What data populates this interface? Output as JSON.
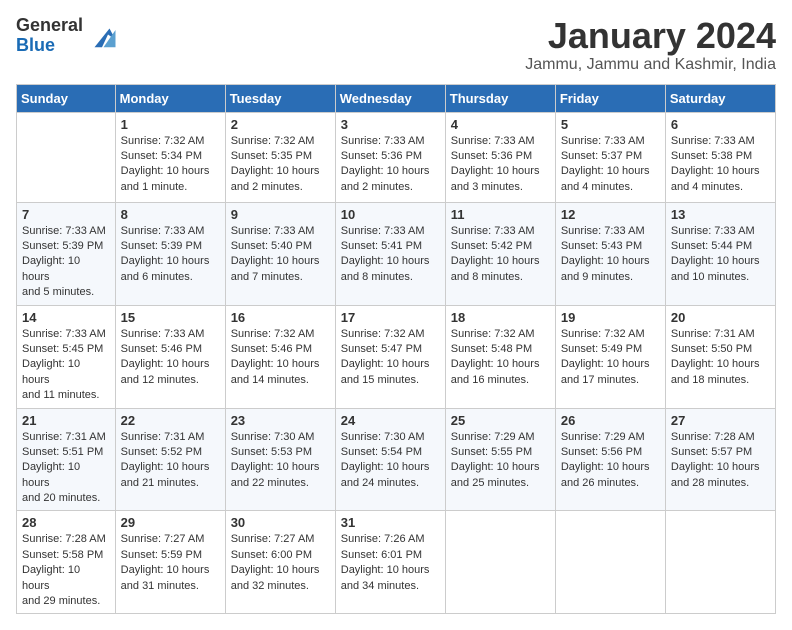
{
  "header": {
    "logo_general": "General",
    "logo_blue": "Blue",
    "month_title": "January 2024",
    "location": "Jammu, Jammu and Kashmir, India"
  },
  "weekdays": [
    "Sunday",
    "Monday",
    "Tuesday",
    "Wednesday",
    "Thursday",
    "Friday",
    "Saturday"
  ],
  "weeks": [
    [
      {
        "day": "",
        "info": ""
      },
      {
        "day": "1",
        "info": "Sunrise: 7:32 AM\nSunset: 5:34 PM\nDaylight: 10 hours\nand 1 minute."
      },
      {
        "day": "2",
        "info": "Sunrise: 7:32 AM\nSunset: 5:35 PM\nDaylight: 10 hours\nand 2 minutes."
      },
      {
        "day": "3",
        "info": "Sunrise: 7:33 AM\nSunset: 5:36 PM\nDaylight: 10 hours\nand 2 minutes."
      },
      {
        "day": "4",
        "info": "Sunrise: 7:33 AM\nSunset: 5:36 PM\nDaylight: 10 hours\nand 3 minutes."
      },
      {
        "day": "5",
        "info": "Sunrise: 7:33 AM\nSunset: 5:37 PM\nDaylight: 10 hours\nand 4 minutes."
      },
      {
        "day": "6",
        "info": "Sunrise: 7:33 AM\nSunset: 5:38 PM\nDaylight: 10 hours\nand 4 minutes."
      }
    ],
    [
      {
        "day": "7",
        "info": "Sunrise: 7:33 AM\nSunset: 5:39 PM\nDaylight: 10 hours\nand 5 minutes."
      },
      {
        "day": "8",
        "info": "Sunrise: 7:33 AM\nSunset: 5:39 PM\nDaylight: 10 hours\nand 6 minutes."
      },
      {
        "day": "9",
        "info": "Sunrise: 7:33 AM\nSunset: 5:40 PM\nDaylight: 10 hours\nand 7 minutes."
      },
      {
        "day": "10",
        "info": "Sunrise: 7:33 AM\nSunset: 5:41 PM\nDaylight: 10 hours\nand 8 minutes."
      },
      {
        "day": "11",
        "info": "Sunrise: 7:33 AM\nSunset: 5:42 PM\nDaylight: 10 hours\nand 8 minutes."
      },
      {
        "day": "12",
        "info": "Sunrise: 7:33 AM\nSunset: 5:43 PM\nDaylight: 10 hours\nand 9 minutes."
      },
      {
        "day": "13",
        "info": "Sunrise: 7:33 AM\nSunset: 5:44 PM\nDaylight: 10 hours\nand 10 minutes."
      }
    ],
    [
      {
        "day": "14",
        "info": "Sunrise: 7:33 AM\nSunset: 5:45 PM\nDaylight: 10 hours\nand 11 minutes."
      },
      {
        "day": "15",
        "info": "Sunrise: 7:33 AM\nSunset: 5:46 PM\nDaylight: 10 hours\nand 12 minutes."
      },
      {
        "day": "16",
        "info": "Sunrise: 7:32 AM\nSunset: 5:46 PM\nDaylight: 10 hours\nand 14 minutes."
      },
      {
        "day": "17",
        "info": "Sunrise: 7:32 AM\nSunset: 5:47 PM\nDaylight: 10 hours\nand 15 minutes."
      },
      {
        "day": "18",
        "info": "Sunrise: 7:32 AM\nSunset: 5:48 PM\nDaylight: 10 hours\nand 16 minutes."
      },
      {
        "day": "19",
        "info": "Sunrise: 7:32 AM\nSunset: 5:49 PM\nDaylight: 10 hours\nand 17 minutes."
      },
      {
        "day": "20",
        "info": "Sunrise: 7:31 AM\nSunset: 5:50 PM\nDaylight: 10 hours\nand 18 minutes."
      }
    ],
    [
      {
        "day": "21",
        "info": "Sunrise: 7:31 AM\nSunset: 5:51 PM\nDaylight: 10 hours\nand 20 minutes."
      },
      {
        "day": "22",
        "info": "Sunrise: 7:31 AM\nSunset: 5:52 PM\nDaylight: 10 hours\nand 21 minutes."
      },
      {
        "day": "23",
        "info": "Sunrise: 7:30 AM\nSunset: 5:53 PM\nDaylight: 10 hours\nand 22 minutes."
      },
      {
        "day": "24",
        "info": "Sunrise: 7:30 AM\nSunset: 5:54 PM\nDaylight: 10 hours\nand 24 minutes."
      },
      {
        "day": "25",
        "info": "Sunrise: 7:29 AM\nSunset: 5:55 PM\nDaylight: 10 hours\nand 25 minutes."
      },
      {
        "day": "26",
        "info": "Sunrise: 7:29 AM\nSunset: 5:56 PM\nDaylight: 10 hours\nand 26 minutes."
      },
      {
        "day": "27",
        "info": "Sunrise: 7:28 AM\nSunset: 5:57 PM\nDaylight: 10 hours\nand 28 minutes."
      }
    ],
    [
      {
        "day": "28",
        "info": "Sunrise: 7:28 AM\nSunset: 5:58 PM\nDaylight: 10 hours\nand 29 minutes."
      },
      {
        "day": "29",
        "info": "Sunrise: 7:27 AM\nSunset: 5:59 PM\nDaylight: 10 hours\nand 31 minutes."
      },
      {
        "day": "30",
        "info": "Sunrise: 7:27 AM\nSunset: 6:00 PM\nDaylight: 10 hours\nand 32 minutes."
      },
      {
        "day": "31",
        "info": "Sunrise: 7:26 AM\nSunset: 6:01 PM\nDaylight: 10 hours\nand 34 minutes."
      },
      {
        "day": "",
        "info": ""
      },
      {
        "day": "",
        "info": ""
      },
      {
        "day": "",
        "info": ""
      }
    ]
  ]
}
